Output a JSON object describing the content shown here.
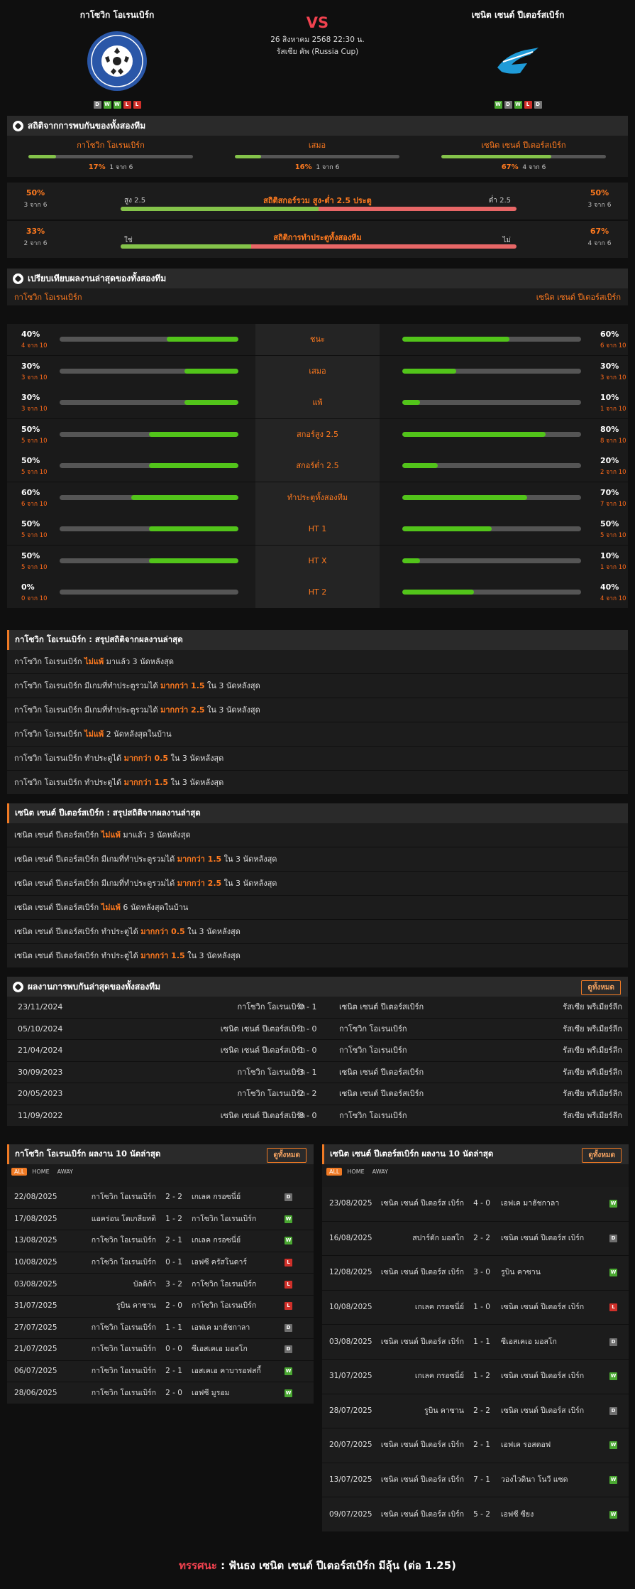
{
  "match": {
    "home": "กาโซวิก โอเรนเบิร์ก",
    "away": "เซนิต เซนต์ ปีเตอร์สเบิร์ก",
    "vs": "VS",
    "date": "26 สิงหาคม 2568 22:30 น.",
    "competition": "รัสเซีย คัพ (Russia Cup)",
    "home_form": [
      "D",
      "W",
      "W",
      "L",
      "L"
    ],
    "away_form": [
      "W",
      "D",
      "W",
      "L",
      "D"
    ]
  },
  "h2h_stats": {
    "title": "สถิติจากการพบกันของทั้งสองทีม",
    "home_label": "กาโซวิก โอเรนเบิร์ก",
    "draw_label": "เสมอ",
    "away_label": "เซนิต เซนต์ ปีเตอร์สเบิร์ก",
    "home_pct": "17%",
    "home_sub": "1 จาก 6",
    "home_val": 17,
    "draw_pct": "16%",
    "draw_sub": "1 จาก 6",
    "draw_val": 16,
    "away_pct": "67%",
    "away_sub": "4 จาก 6",
    "away_val": 67
  },
  "ou": {
    "title": "สถิติสกอร์รวม สูง-ต่ำ 2.5 ประตู",
    "left_pct": "50%",
    "left_sub": "3 จาก 6",
    "right_pct": "50%",
    "right_sub": "3 จาก 6",
    "left_lab": "สูง 2.5",
    "right_lab": "ต่ำ 2.5",
    "over_val": 50
  },
  "btts": {
    "title": "สถิติการทำประตูทั้งสองทีม",
    "left_pct": "33%",
    "left_sub": "2 จาก 6",
    "right_pct": "67%",
    "right_sub": "4 จาก 6",
    "left_lab": "ใช่",
    "right_lab": "ไม่",
    "yes_val": 33
  },
  "compare": {
    "title": "เปรียบเทียบผลงานล่าสุดของทั้งสองทีม",
    "home": "กาโซวิก โอเรนเบิร์ก",
    "away": "เซนิต เซนต์ ปีเตอร์สเบิร์ก",
    "rows": [
      {
        "label": "ชนะ",
        "hp": "40%",
        "hs": "4 จาก 10",
        "hv": 40,
        "ap": "60%",
        "as": "6 จาก 10",
        "av": 60
      },
      {
        "label": "เสมอ",
        "hp": "30%",
        "hs": "3 จาก 10",
        "hv": 30,
        "ap": "30%",
        "as": "3 จาก 10",
        "av": 30
      },
      {
        "label": "แพ้",
        "hp": "30%",
        "hs": "3 จาก 10",
        "hv": 30,
        "ap": "10%",
        "as": "1 จาก 10",
        "av": 10
      },
      {
        "label": "สกอร์สูง 2.5",
        "hp": "50%",
        "hs": "5 จาก 10",
        "hv": 50,
        "ap": "80%",
        "as": "8 จาก 10",
        "av": 80
      },
      {
        "label": "สกอร์ต่ำ 2.5",
        "hp": "50%",
        "hs": "5 จาก 10",
        "hv": 50,
        "ap": "20%",
        "as": "2 จาก 10",
        "av": 20
      },
      {
        "label": "ทำประตูทั้งสองทีม",
        "hp": "60%",
        "hs": "6 จาก 10",
        "hv": 60,
        "ap": "70%",
        "as": "7 จาก 10",
        "av": 70
      },
      {
        "label": "HT 1",
        "hp": "50%",
        "hs": "5 จาก 10",
        "hv": 50,
        "ap": "50%",
        "as": "5 จาก 10",
        "av": 50
      },
      {
        "label": "HT X",
        "hp": "50%",
        "hs": "5 จาก 10",
        "hv": 50,
        "ap": "10%",
        "as": "1 จาก 10",
        "av": 10
      },
      {
        "label": "HT 2",
        "hp": "0%",
        "hs": "0 จาก 10",
        "hv": 0,
        "ap": "40%",
        "as": "4 จาก 10",
        "av": 40
      }
    ]
  },
  "home_summary": {
    "title": "กาโซวิก โอเรนเบิร์ก : สรุปสถิติจากผลงานล่าสุด",
    "rows": [
      [
        "กาโซวิก โอเรนเบิร์ก ",
        "ไม่แพ้",
        " มาแล้ว 3 นัดหลังสุด"
      ],
      [
        "กาโซวิก โอเรนเบิร์ก  มีเกมที่ทำประตูรวมได้ ",
        "มากกว่า 1.5",
        " ใน 3 นัดหลังสุด"
      ],
      [
        "กาโซวิก โอเรนเบิร์ก  มีเกมที่ทำประตูรวมได้ ",
        "มากกว่า 2.5",
        " ใน 3 นัดหลังสุด"
      ],
      [
        "กาโซวิก โอเรนเบิร์ก ",
        "ไม่แพ้",
        " 2  นัดหลังสุดในบ้าน"
      ],
      [
        "กาโซวิก โอเรนเบิร์ก  ทำประตูได้ ",
        "มากกว่า 0.5",
        " ใน 3 นัดหลังสุด"
      ],
      [
        "กาโซวิก โอเรนเบิร์ก  ทำประตูได้ ",
        "มากกว่า 1.5",
        " ใน 3 นัดหลังสุด"
      ]
    ]
  },
  "away_summary": {
    "title": "เซนิต เซนต์ ปีเตอร์สเบิร์ก : สรุปสถิติจากผลงานล่าสุด",
    "rows": [
      [
        "เซนิต เซนต์ ปีเตอร์สเบิร์ก ",
        "ไม่แพ้",
        " มาแล้ว 3 นัดหลังสุด"
      ],
      [
        "เซนิต เซนต์ ปีเตอร์สเบิร์ก  มีเกมที่ทำประตูรวมได้ ",
        "มากกว่า 1.5",
        " ใน 3 นัดหลังสุด"
      ],
      [
        "เซนิต เซนต์ ปีเตอร์สเบิร์ก  มีเกมที่ทำประตูรวมได้ ",
        "มากกว่า 2.5",
        " ใน 3 นัดหลังสุด"
      ],
      [
        "เซนิต เซนต์ ปีเตอร์สเบิร์ก ",
        "ไม่แพ้",
        " 6  นัดหลังสุดในบ้าน"
      ],
      [
        "เซนิต เซนต์ ปีเตอร์สเบิร์ก  ทำประตูได้ ",
        "มากกว่า 0.5",
        " ใน 3 นัดหลังสุด"
      ],
      [
        "เซนิต เซนต์ ปีเตอร์สเบิร์ก  ทำประตูได้ ",
        "มากกว่า 1.5",
        " ใน 3 นัดหลังสุด"
      ]
    ]
  },
  "h2h": {
    "title": "ผลงานการพบกันล่าสุดของทั้งสองทีม",
    "view_all": "ดูทั้งหมด",
    "rows": [
      [
        "23/11/2024",
        "กาโซวิก โอเรนเบิร์ก",
        "0 - 1",
        "เซนิต เซนต์ ปีเตอร์สเบิร์ก",
        "รัสเซีย พรีเมียร์ลีก"
      ],
      [
        "05/10/2024",
        "เซนิต เซนต์ ปีเตอร์สเบิร์ก",
        "1 - 0",
        "กาโซวิก โอเรนเบิร์ก",
        "รัสเซีย พรีเมียร์ลีก"
      ],
      [
        "21/04/2024",
        "เซนิต เซนต์ ปีเตอร์สเบิร์ก",
        "1 - 0",
        "กาโซวิก โอเรนเบิร์ก",
        "รัสเซีย พรีเมียร์ลีก"
      ],
      [
        "30/09/2023",
        "กาโซวิก โอเรนเบิร์ก",
        "3 - 1",
        "เซนิต เซนต์ ปีเตอร์สเบิร์ก",
        "รัสเซีย พรีเมียร์ลีก"
      ],
      [
        "20/05/2023",
        "กาโซวิก โอเรนเบิร์ก",
        "2 - 2",
        "เซนิต เซนต์ ปีเตอร์สเบิร์ก",
        "รัสเซีย พรีเมียร์ลีก"
      ],
      [
        "11/09/2022",
        "เซนิต เซนต์ ปีเตอร์สเบิร์ก",
        "8 - 0",
        "กาโซวิก โอเรนเบิร์ก",
        "รัสเซีย พรีเมียร์ลีก"
      ]
    ]
  },
  "home_last10": {
    "title": "กาโซวิก โอเรนเบิร์ก ผลงาน 10 นัดล่าสุด",
    "view_all": "ดูทั้งหมด",
    "tabs": [
      "ALL",
      "HOME",
      "AWAY"
    ],
    "rows": [
      [
        "22/08/2025",
        "กาโซวิก โอเรนเบิร์ก",
        "2 - 2",
        "เกเลค กรอซนี่ย์",
        "D"
      ],
      [
        "17/08/2025",
        "แอคร่อน โตเกลียทติ",
        "1 - 2",
        "กาโซวิก โอเรนเบิร์ก",
        "W"
      ],
      [
        "13/08/2025",
        "กาโซวิก โอเรนเบิร์ก",
        "2 - 1",
        "เกเลค กรอซนี่ย์",
        "W"
      ],
      [
        "10/08/2025",
        "กาโซวิก โอเรนเบิร์ก",
        "0 - 1",
        "เอฟซี ครัสโนดาร์",
        "L"
      ],
      [
        "03/08/2025",
        "บัลติก้า",
        "3 - 2",
        "กาโซวิก โอเรนเบิร์ก",
        "L"
      ],
      [
        "31/07/2025",
        "รูบิน คาซาน",
        "2 - 0",
        "กาโซวิก โอเรนเบิร์ก",
        "L"
      ],
      [
        "27/07/2025",
        "กาโซวิก โอเรนเบิร์ก",
        "1 - 1",
        "เอฟเค มาฮัชกาลา",
        "D"
      ],
      [
        "21/07/2025",
        "กาโซวิก โอเรนเบิร์ก",
        "0 - 0",
        "ซีเอสเคเอ มอสโก",
        "D"
      ],
      [
        "06/07/2025",
        "กาโซวิก โอเรนเบิร์ก",
        "2 - 1",
        "เอสเคเอ คาบารอฟสกี้",
        "W"
      ],
      [
        "28/06/2025",
        "กาโซวิก โอเรนเบิร์ก",
        "2 - 0",
        "เอฟซี มูรอม",
        "W"
      ]
    ]
  },
  "away_last10": {
    "title": "เซนิต เซนต์ ปีเตอร์สเบิร์ก ผลงาน 10 นัดล่าสุด",
    "view_all": "ดูทั้งหมด",
    "tabs": [
      "ALL",
      "HOME",
      "AWAY"
    ],
    "rows": [
      [
        "23/08/2025",
        "เซนิต เซนต์ ปีเตอร์ส เบิร์ก",
        "4 - 0",
        "เอฟเค มาฮัชกาลา",
        "W"
      ],
      [
        "16/08/2025",
        "สปาร์ตัก มอสโก",
        "2 - 2",
        "เซนิต เซนต์ ปีเตอร์ส เบิร์ก",
        "D"
      ],
      [
        "12/08/2025",
        "เซนิต เซนต์ ปีเตอร์ส เบิร์ก",
        "3 - 0",
        "รูบิน คาซาน",
        "W"
      ],
      [
        "10/08/2025",
        "เกเลค กรอซนี่ย์",
        "1 - 0",
        "เซนิต เซนต์ ปีเตอร์ส เบิร์ก",
        "L"
      ],
      [
        "03/08/2025",
        "เซนิต เซนต์ ปีเตอร์ส เบิร์ก",
        "1 - 1",
        "ซีเอสเคเอ มอสโก",
        "D"
      ],
      [
        "31/07/2025",
        "เกเลค กรอซนี่ย์",
        "1 - 2",
        "เซนิต เซนต์ ปีเตอร์ส เบิร์ก",
        "W"
      ],
      [
        "28/07/2025",
        "รูบิน คาซาน",
        "2 - 2",
        "เซนิต เซนต์ ปีเตอร์ส เบิร์ก",
        "D"
      ],
      [
        "20/07/2025",
        "เซนิต เซนต์ ปีเตอร์ส เบิร์ก",
        "2 - 1",
        "เอฟเค รอสตอฟ",
        "W"
      ],
      [
        "13/07/2025",
        "เซนิต เซนต์ ปีเตอร์ส เบิร์ก",
        "7 - 1",
        "วองไวดินา โนวี แซด",
        "W"
      ],
      [
        "09/07/2025",
        "เซนิต เซนต์ ปีเตอร์ส เบิร์ก",
        "5 - 2",
        "เอฟซี ซียง",
        "W"
      ]
    ]
  },
  "prediction": {
    "label": "ทรรศนะ",
    "text": " :  ฟันธง เซนิต เซนต์ ปีเตอร์สเบิร์ก มีลุ้น (ต่อ 1.25)"
  }
}
